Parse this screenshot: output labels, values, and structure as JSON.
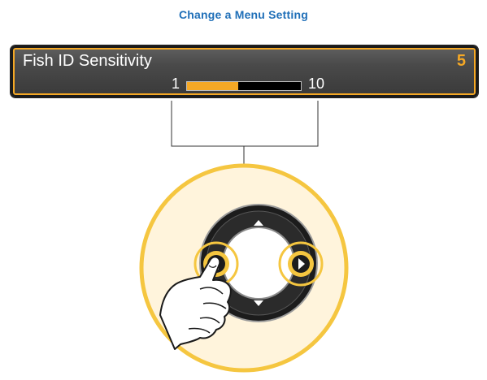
{
  "heading": "Change a Menu Setting",
  "menu": {
    "label": "Fish ID Sensitivity",
    "value": "5",
    "scale_min": "1",
    "scale_max": "10",
    "slider_fraction": 0.45
  },
  "colors": {
    "heading": "#1f6fb8",
    "accent": "#f5a825",
    "panel": "#4a4a4a",
    "highlight_circle": "#fff4dc"
  },
  "icons": [
    "up-arrow-icon",
    "down-arrow-icon",
    "left-arrow-icon",
    "right-arrow-icon",
    "pointing-hand-icon"
  ]
}
